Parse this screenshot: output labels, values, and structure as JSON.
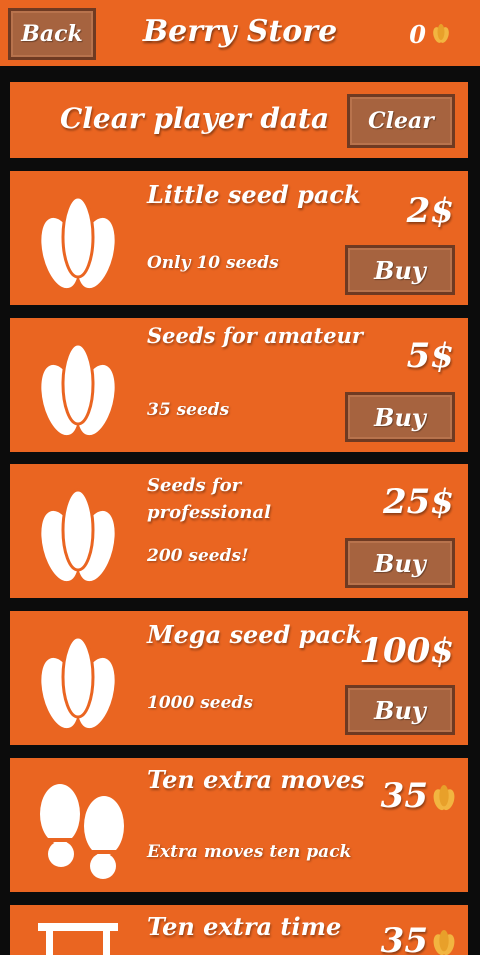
{
  "header": {
    "back_label": "Back",
    "title": "Berry Store",
    "balance": "0"
  },
  "clear": {
    "label": "Clear player data",
    "button": "Clear"
  },
  "items": [
    {
      "title": "Little seed pack",
      "subtitle": "Only 10 seeds",
      "price": "2$",
      "button": "Buy",
      "icon": "seed-icon"
    },
    {
      "title": "Seeds for amateur",
      "subtitle": "35 seeds",
      "price": "5$",
      "button": "Buy",
      "icon": "seed-icon"
    },
    {
      "title": "Seeds for professional",
      "subtitle": "200 seeds!",
      "price": "25$",
      "button": "Buy",
      "icon": "seed-icon"
    },
    {
      "title": "Mega seed pack",
      "subtitle": "1000 seeds",
      "price": "100$",
      "button": "Buy",
      "icon": "seed-icon"
    },
    {
      "title": "Ten extra moves",
      "subtitle": "Extra moves ten pack",
      "price": "35",
      "icon": "footprints-icon"
    },
    {
      "title": "Ten extra time",
      "price": "35",
      "icon": "table-icon"
    }
  ],
  "colors": {
    "background": "#0c0c0c",
    "panel": "#ea6521",
    "button": "#a6633f",
    "seed_accent": "#f2b540"
  }
}
